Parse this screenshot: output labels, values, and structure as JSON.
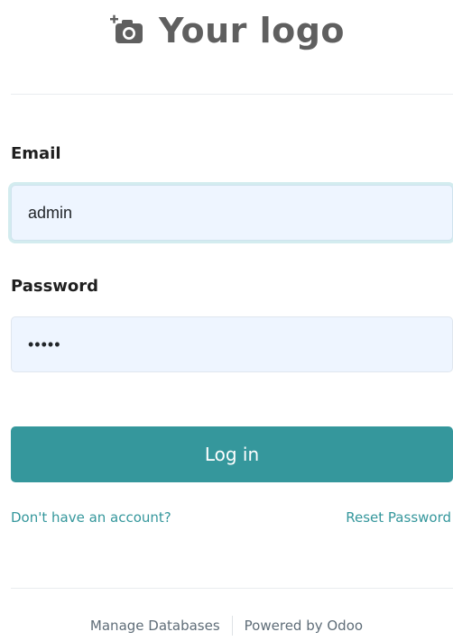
{
  "brand": {
    "logo_text": "Your logo",
    "logo_icon": "camera-add-icon"
  },
  "form": {
    "email_label": "Email",
    "email_value": "admin",
    "password_label": "Password",
    "password_value": "admin",
    "login_label": "Log in"
  },
  "links": {
    "signup": "Don't have an account?",
    "reset": "Reset Password"
  },
  "footer": {
    "manage_databases": "Manage Databases",
    "powered_by": "Powered by Odoo"
  },
  "colors": {
    "accent": "#35979c",
    "input_bg": "#eef5ff",
    "logo_gray": "#5f5f5f"
  }
}
